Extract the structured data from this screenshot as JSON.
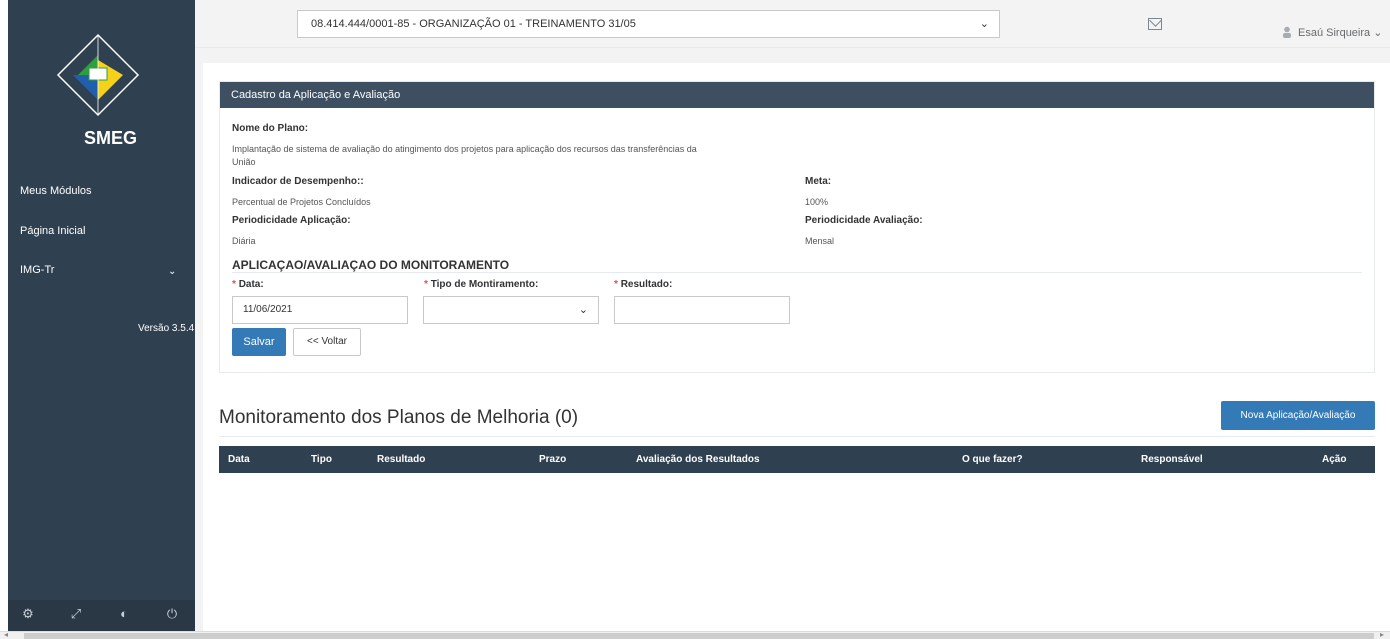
{
  "sidebar": {
    "brand": "SMEG",
    "items": [
      {
        "label": "Meus Módulos"
      },
      {
        "label": "Página Inicial"
      },
      {
        "label": "IMG-Tr"
      }
    ],
    "version": "Versão 3.5.4",
    "footer_icons": [
      "gear-icon",
      "expand-icon",
      "hide-icon",
      "power-icon"
    ]
  },
  "topbar": {
    "org_select": "08.414.444/0001-85 - ORGANIZAÇÃO 01 - TREINAMENTO 31/05",
    "user_name": "Esaú Sirqueira"
  },
  "panel": {
    "title": "Cadastro da Aplicação e Avaliação",
    "nome_plano_label": "Nome do Plano:",
    "nome_plano_value_1": "Implantação de sistema de avaliação do atingimento dos projetos para aplicação dos recursos das transferências da",
    "nome_plano_value_2": "União",
    "indicador_label": "Indicador de Desempenho::",
    "indicador_value": "Percentual de Projetos Concluídos",
    "meta_label": "Meta:",
    "meta_value": "100%",
    "per_aplic_label": "Periodicidade Aplicação:",
    "per_aplic_value": "Diária",
    "per_aval_label": "Periodicidade Avaliação:",
    "per_aval_value": "Mensal",
    "section_title": "APLICAÇAO/AVALIAÇAO DO MONITORAMENTO",
    "required_mark": "*",
    "data_label": "Data:",
    "data_value": "11/06/2021",
    "tipo_label": "Tipo de Montiramento:",
    "tipo_value": "",
    "resultado_label": "Resultado:",
    "resultado_value": "",
    "save_label": "Salvar",
    "back_label": "<< Voltar"
  },
  "monitoring": {
    "title": "Monitoramento dos Planos de Melhoria (0)",
    "new_button": "Nova Aplicação/Avaliação",
    "columns": [
      "Data",
      "Tipo",
      "Resultado",
      "Prazo",
      "Avaliação dos Resultados",
      "O que fazer?",
      "Responsável",
      "Ação"
    ]
  },
  "colors": {
    "sidebar": "#2f4050",
    "panel_header": "#3d4f60",
    "primary_button": "#337ab7",
    "required": "#d9534f"
  }
}
